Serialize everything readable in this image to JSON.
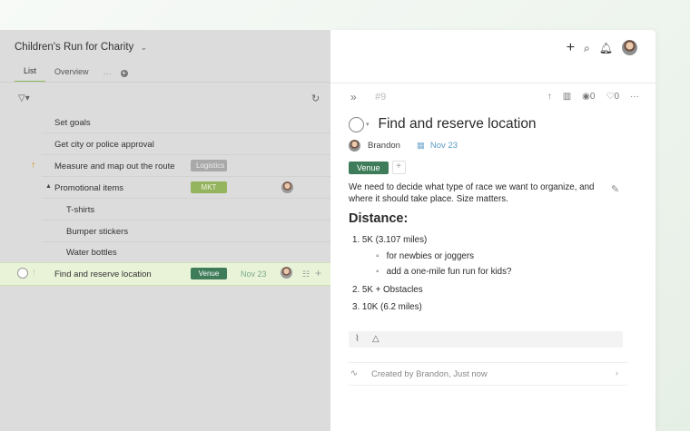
{
  "project": {
    "title": "Children's Run for Charity"
  },
  "tabs": [
    {
      "label": "List",
      "active": true
    },
    {
      "label": "Overview",
      "active": false
    }
  ],
  "tasks": [
    {
      "name": "Set goals"
    },
    {
      "name": "Get city or police approval"
    },
    {
      "name": "Measure and map out the route",
      "tag": "Logistics",
      "priority_up": true
    },
    {
      "name": "Promotional items",
      "tag": "MKT",
      "has_assignee": true,
      "expanded": true
    },
    {
      "name": "T-shirts"
    },
    {
      "name": "Bumper stickers"
    },
    {
      "name": "Water bottles"
    },
    {
      "name": "Find and reserve location",
      "tag": "Venue",
      "date": "Nov 23",
      "selected": true
    }
  ],
  "detail": {
    "id": "#9",
    "views": "0",
    "likes": "0",
    "title": "Find and reserve location",
    "assignee": "Brandon",
    "due": "Nov 23",
    "tag": "Venue",
    "description": "We need to decide what type of race we want to organize, and where it should take place. Size matters.",
    "heading": "Distance:",
    "list": [
      {
        "num": "1.",
        "text": "5K (3.107 miles)"
      },
      {
        "bullet": "◦",
        "text": "for newbies or joggers"
      },
      {
        "bullet": "◦",
        "text": "add a one-mile fun run for kids?"
      },
      {
        "num": "2.",
        "text": "5K + Obstacles"
      },
      {
        "num": "3.",
        "text": "10K (6.2 miles)"
      }
    ],
    "activity": "Created by Brandon, Just now"
  },
  "colors": {
    "venue": "#3f7d5a",
    "mkt": "#95b45e",
    "logistics": "#a9a9a9",
    "accent": "#8bb75a"
  }
}
